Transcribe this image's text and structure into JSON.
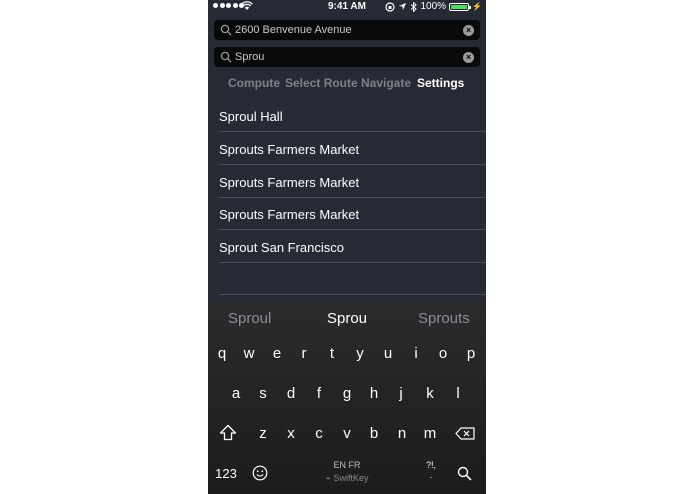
{
  "status_bar": {
    "time": "9:41 AM",
    "battery": "100%",
    "battery_level": 1.0,
    "icons": [
      "signal-dots-icon",
      "wifi-icon",
      "lock-rotation-icon",
      "location-arrow-icon",
      "bluetooth-icon",
      "battery-icon",
      "charging-bolt-icon"
    ]
  },
  "search": {
    "origin_value": "2600 Benvenue Avenue",
    "destination_value": "Sprou"
  },
  "tabs": [
    {
      "label": "Compute",
      "active": false
    },
    {
      "label": "Select Route",
      "active": false
    },
    {
      "label": "Navigate",
      "active": false
    },
    {
      "label": "Settings",
      "active": true
    }
  ],
  "results": [
    "Sproul Hall",
    "Sprouts Farmers Market",
    "Sprouts Farmers Market",
    "Sprouts Farmers Market",
    "Sprout San Francisco"
  ],
  "keyboard": {
    "suggestions": [
      "Sproul",
      "Sprou",
      "Sprouts"
    ],
    "row1": [
      "q",
      "w",
      "e",
      "r",
      "t",
      "y",
      "u",
      "i",
      "o",
      "p"
    ],
    "row2": [
      "a",
      "s",
      "d",
      "f",
      "g",
      "h",
      "j",
      "k",
      "l"
    ],
    "row3": [
      "z",
      "x",
      "c",
      "v",
      "b",
      "n",
      "m"
    ],
    "numbers_key": "123",
    "language": "EN FR",
    "brand": "SwiftKey",
    "punct_key": "?!,",
    "punct_key_sub": ".",
    "colors": {
      "background": "#262a34",
      "accent_battery": "#4cd964"
    }
  }
}
